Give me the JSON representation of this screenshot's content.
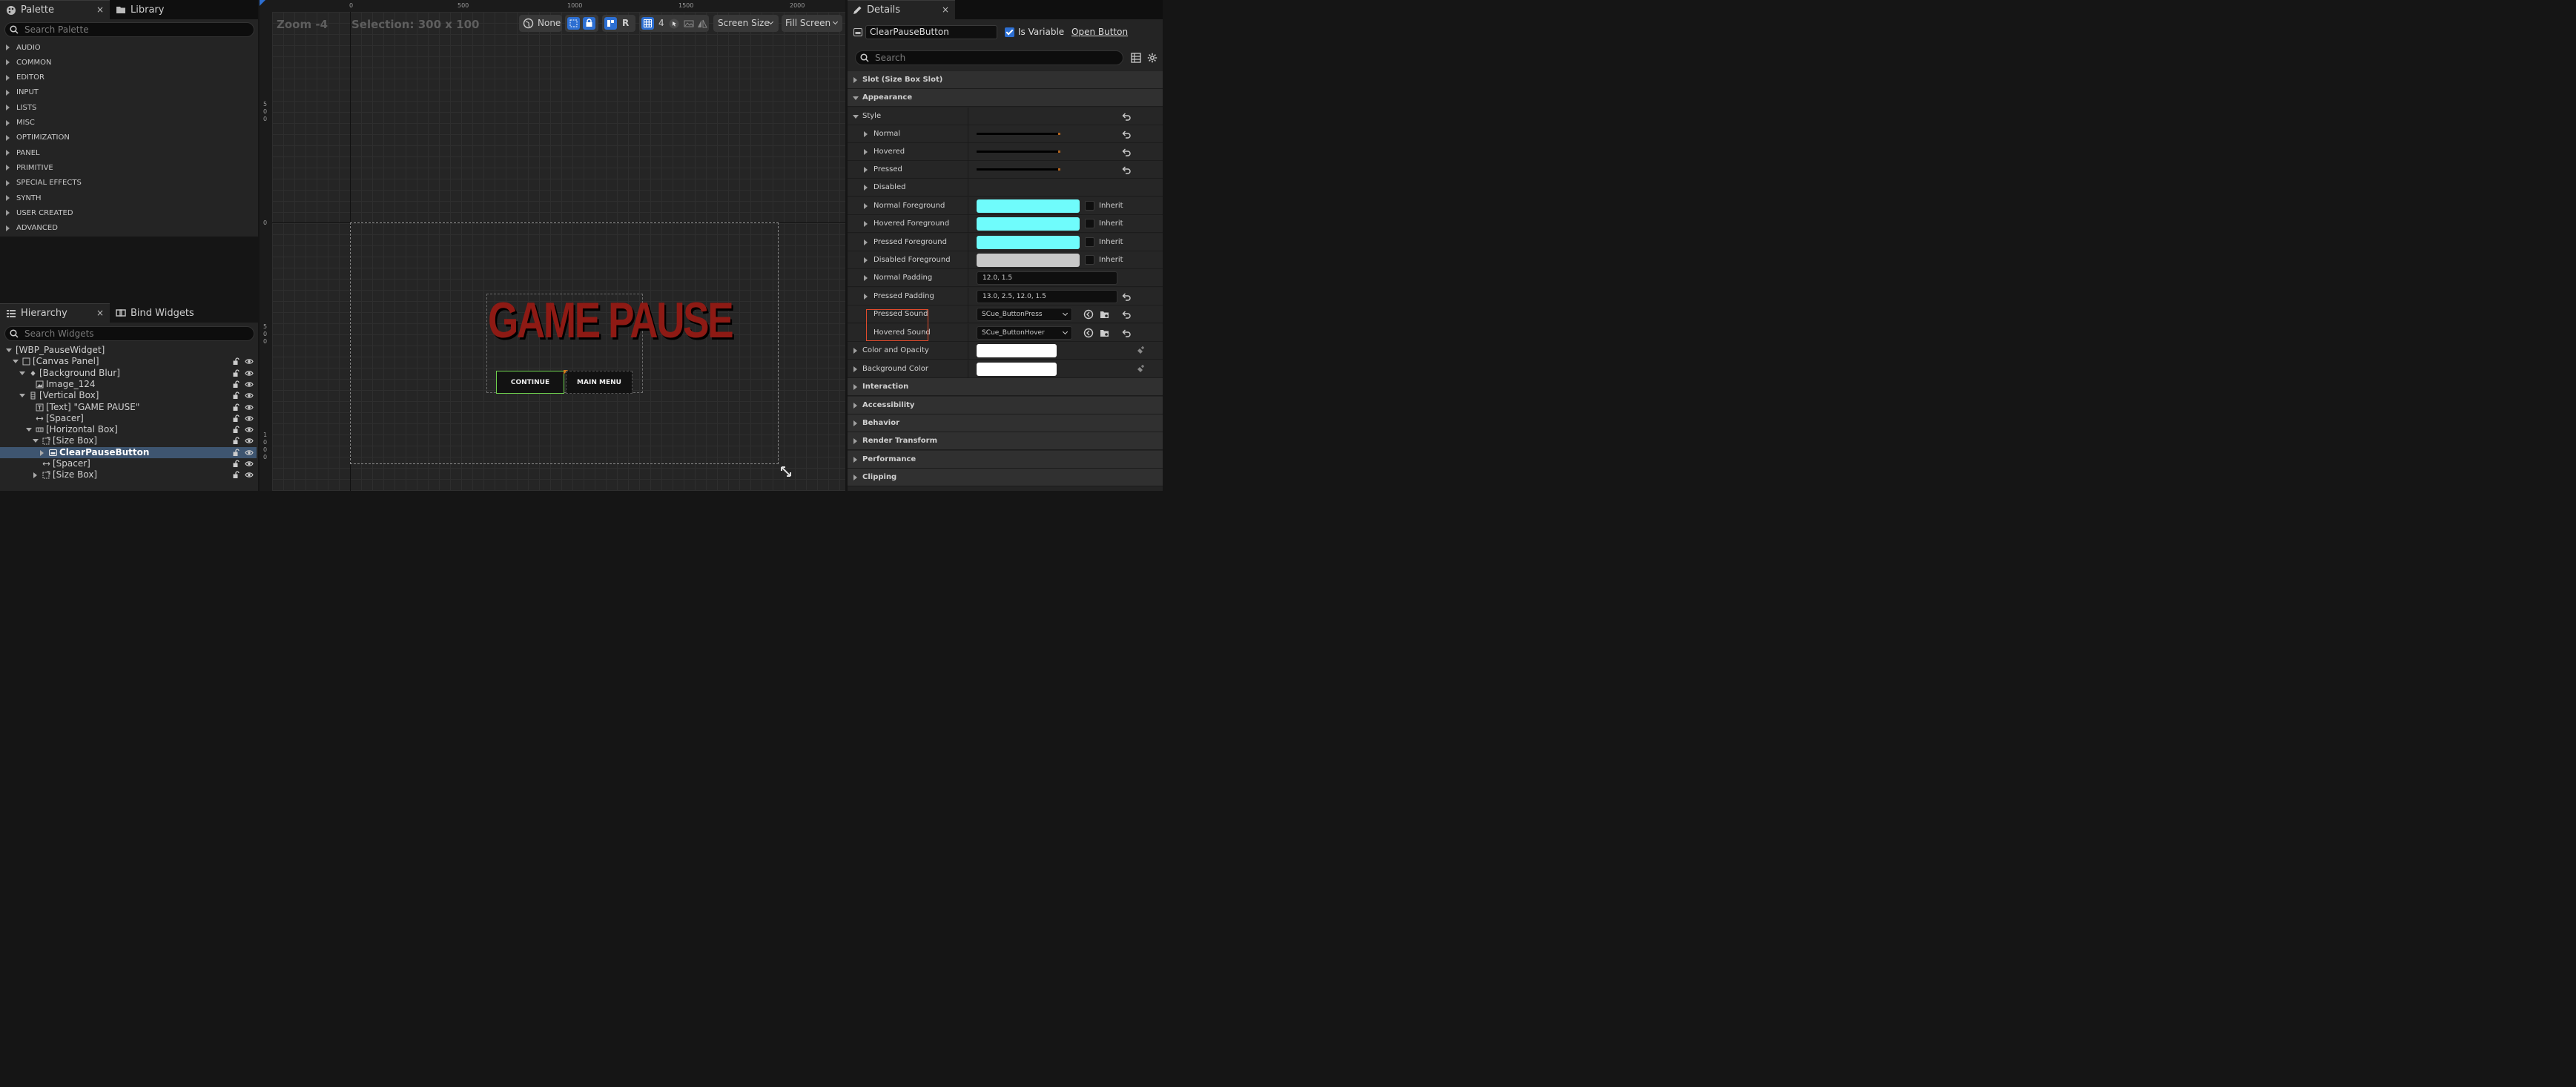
{
  "palette": {
    "tab_label": "Palette",
    "close": "×",
    "library_tab": "Library",
    "search_placeholder": "Search Palette",
    "categories": [
      "AUDIO",
      "COMMON",
      "EDITOR",
      "INPUT",
      "LISTS",
      "MISC",
      "OPTIMIZATION",
      "PANEL",
      "PRIMITIVE",
      "SPECIAL EFFECTS",
      "SYNTH",
      "USER CREATED",
      "ADVANCED"
    ]
  },
  "hierarchy": {
    "tab_label": "Hierarchy",
    "close": "×",
    "bind_tab": "Bind Widgets",
    "search_placeholder": "Search Widgets",
    "items": [
      {
        "label": "[WBP_PauseWidget]"
      },
      {
        "label": "[Canvas Panel]"
      },
      {
        "label": "[Background Blur]"
      },
      {
        "label": "Image_124"
      },
      {
        "label": "[Vertical Box]"
      },
      {
        "label": "[Text] \"GAME PAUSE\""
      },
      {
        "label": "[Spacer]"
      },
      {
        "label": "[Horizontal Box]"
      },
      {
        "label": "[Size Box]"
      },
      {
        "label": "ClearPauseButton"
      },
      {
        "label": "[Spacer]"
      },
      {
        "label": "[Size Box]"
      }
    ]
  },
  "canvas": {
    "zoom": "Zoom -4",
    "selection": "Selection: 300 x 100",
    "ruler_top": [
      "0",
      "500",
      "1000",
      "1500",
      "2000"
    ],
    "ruler_left": [
      "500",
      "0",
      "500",
      "1000"
    ],
    "toolbar": {
      "none_label": "None",
      "r_label": "R",
      "grid_value": "4",
      "screen_size": "Screen Size",
      "fill_screen": "Fill Screen"
    },
    "preview": {
      "title": "GAME PAUSE",
      "continue": "CONTINUE",
      "main_menu": "MAIN MENU"
    }
  },
  "details": {
    "tab_label": "Details",
    "close": "×",
    "name": "ClearPauseButton",
    "is_variable": "Is Variable",
    "open_button": "Open Button",
    "search_placeholder": "Search",
    "rows": {
      "slot": "Slot (Size Box Slot)",
      "appearance": "Appearance",
      "style": "Style",
      "normal": "Normal",
      "hovered": "Hovered",
      "pressed": "Pressed",
      "disabled": "Disabled",
      "normal_fg": "Normal Foreground",
      "hovered_fg": "Hovered Foreground",
      "pressed_fg": "Pressed Foreground",
      "disabled_fg": "Disabled Foreground",
      "inherit": "Inherit",
      "normal_padding": "Normal Padding",
      "normal_padding_value": "12.0, 1.5",
      "pressed_padding": "Pressed Padding",
      "pressed_padding_value": "13.0, 2.5, 12.0, 1.5",
      "pressed_sound": "Pressed Sound",
      "pressed_sound_value": "SCue_ButtonPress",
      "hovered_sound": "Hovered Sound",
      "hovered_sound_value": "SCue_ButtonHover",
      "color_opacity": "Color and Opacity",
      "background_color": "Background Color",
      "interaction": "Interaction",
      "accessibility": "Accessibility",
      "behavior": "Behavior",
      "render_transform": "Render Transform",
      "performance": "Performance",
      "clipping": "Clipping"
    },
    "colors": {
      "foreground": "#6ffcfc",
      "disabled_foreground": "#c8c8c8",
      "white": "#ffffff"
    }
  }
}
